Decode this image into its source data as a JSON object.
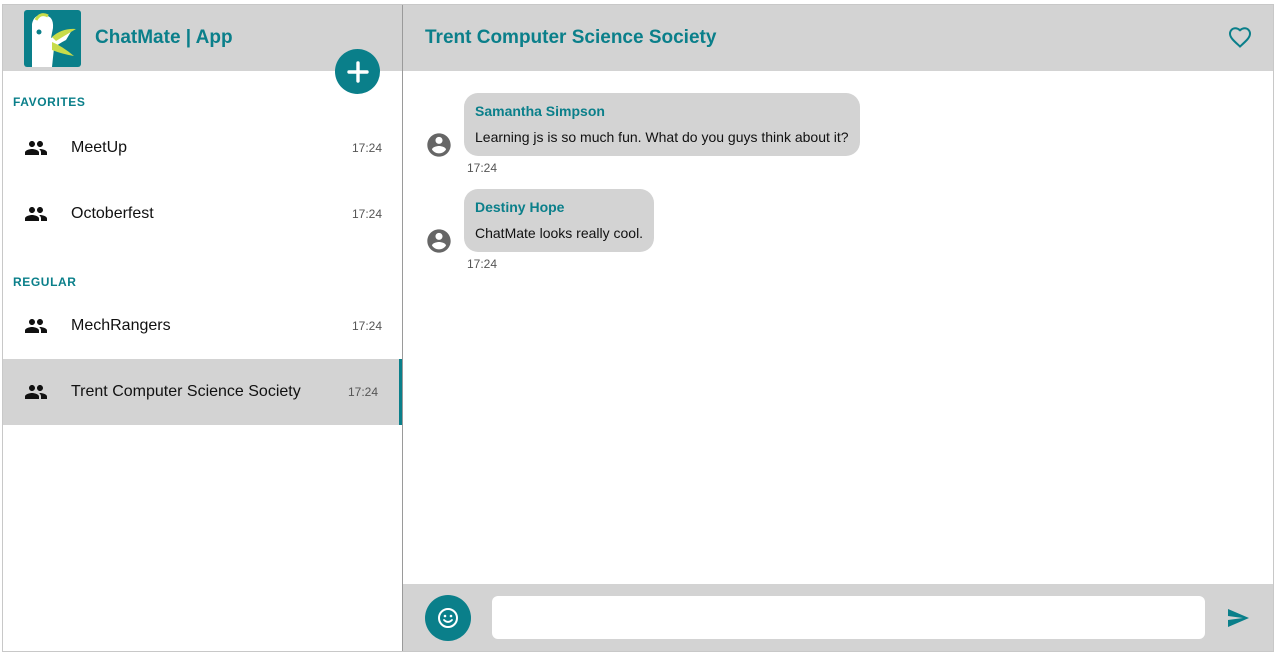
{
  "app": {
    "title": "ChatMate | App"
  },
  "colors": {
    "accent": "#0a7f8a",
    "panel": "#d3d3d3"
  },
  "sidebar": {
    "favorites_label": "FAVORITES",
    "regular_label": "REGULAR",
    "favorites": [
      {
        "name": "MeetUp",
        "time": "17:24",
        "icon": "group-icon"
      },
      {
        "name": "Octoberfest",
        "time": "17:24",
        "icon": "group-icon"
      }
    ],
    "regular": [
      {
        "name": "MechRangers",
        "time": "17:24",
        "icon": "group-icon"
      },
      {
        "name": "Trent Computer Science Society",
        "time": "17:24",
        "icon": "group-icon",
        "active": true
      }
    ]
  },
  "room": {
    "title": "Trent Computer Science Society",
    "messages": [
      {
        "sender": "Samantha Simpson",
        "text": "Learning js is so much fun. What do you guys think about it?",
        "time": "17:24"
      },
      {
        "sender": "Destiny Hope",
        "text": "ChatMate looks really cool.",
        "time": "17:24"
      }
    ]
  },
  "composer": {
    "value": "",
    "placeholder": ""
  }
}
